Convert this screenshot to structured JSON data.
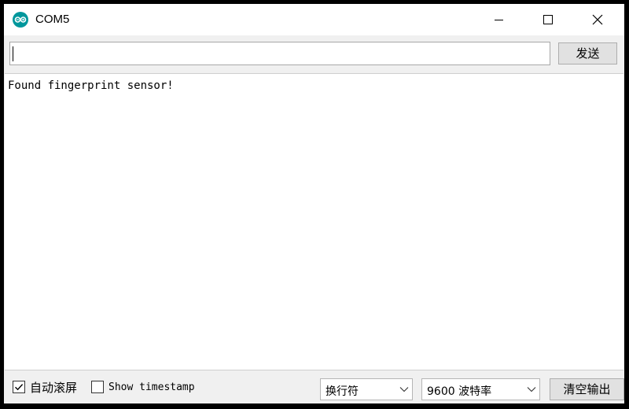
{
  "window": {
    "title": "COM5",
    "app_icon": "arduino-icon",
    "controls": [
      "minimize-icon",
      "maximize-icon",
      "close-icon"
    ]
  },
  "input_bar": {
    "value": "",
    "send_label": "发送"
  },
  "output": {
    "lines": [
      "Found fingerprint sensor!"
    ]
  },
  "status_bar": {
    "autoscroll": {
      "label": "自动滚屏",
      "checked": true
    },
    "timestamp": {
      "label": "Show timestamp",
      "checked": false
    },
    "line_ending": {
      "selected": "换行符"
    },
    "baud_rate": {
      "selected": "9600 波特率"
    },
    "clear_label": "清空输出"
  },
  "colors": {
    "app_icon": "#00979c",
    "chrome": "#f0f0f0",
    "button_face": "#e1e1e1"
  }
}
